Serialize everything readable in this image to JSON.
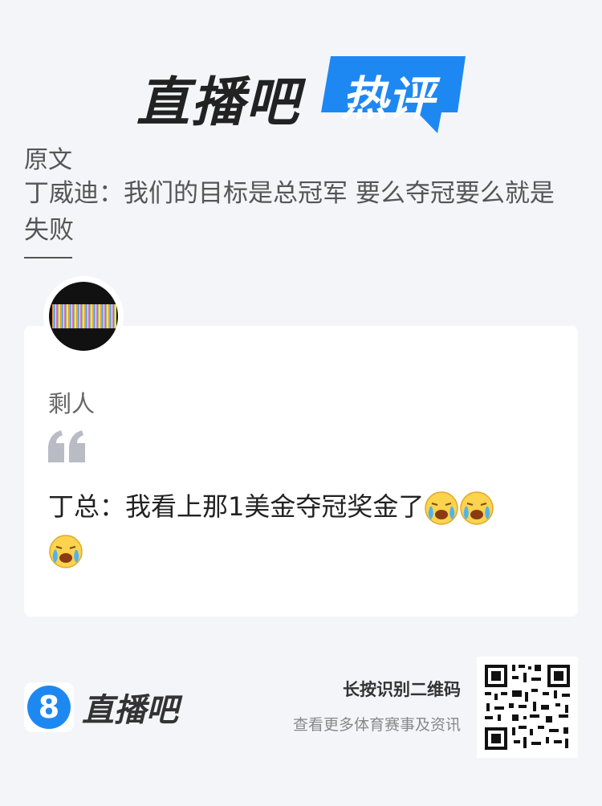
{
  "header": {
    "logo_text": "直播吧",
    "badge_text": "热评",
    "badge_color": "#1e88f2"
  },
  "article": {
    "original_label": "原文",
    "title": "丁威迪：我们的目标是总冠军 要么夺冠要么就是失败"
  },
  "comment": {
    "avatar_icon": "user-avatar",
    "username": "剩人",
    "quote_icon": "quote-mark-icon",
    "text": "丁总：我看上那1美金夺冠奖金了",
    "emojis": [
      "crying-face-icon",
      "crying-face-icon",
      "crying-face-icon"
    ]
  },
  "footer": {
    "logo_number": "8",
    "logo_text": "直播吧",
    "qr_title": "长按识别二维码",
    "qr_subtitle": "查看更多体育赛事及资讯",
    "brand_color": "#1e88f2"
  }
}
